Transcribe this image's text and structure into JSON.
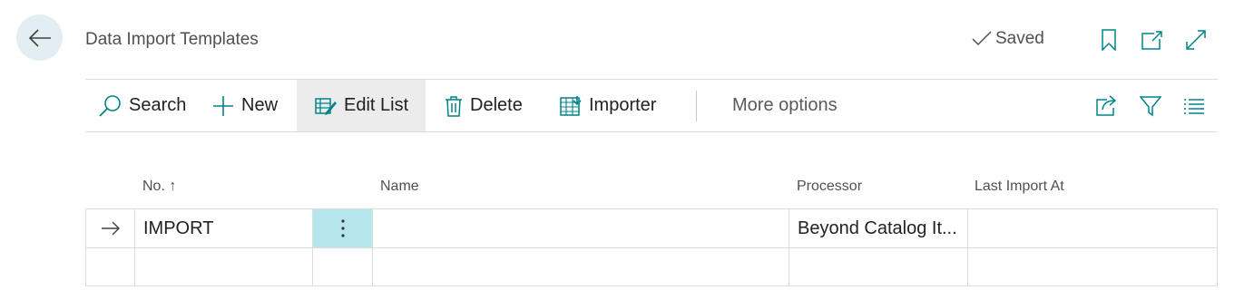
{
  "header": {
    "title": "Data Import Templates",
    "saved_label": "Saved"
  },
  "toolbar": {
    "search_label": "Search",
    "new_label": "New",
    "edit_list_label": "Edit List",
    "delete_label": "Delete",
    "importer_label": "Importer",
    "more_options_label": "More options"
  },
  "table": {
    "columns": [
      "No.",
      "Name",
      "Processor",
      "Last Import At"
    ],
    "sort_indicator": "↑",
    "rows": [
      {
        "no": "IMPORT",
        "name": "",
        "processor": "Beyond Catalog It...",
        "last_import_at": ""
      }
    ]
  },
  "colors": {
    "accent": "#008489",
    "back_bg": "#e2eef1",
    "active_cell": "#b5e6ec"
  },
  "icons": [
    "back-arrow-icon",
    "checkmark-icon",
    "bookmark-icon",
    "open-new-window-icon",
    "expand-icon",
    "search-icon",
    "plus-icon",
    "edit-list-icon",
    "trash-icon",
    "importer-icon",
    "share-icon",
    "filter-icon",
    "list-view-icon",
    "row-arrow-icon",
    "more-vertical-icon"
  ]
}
